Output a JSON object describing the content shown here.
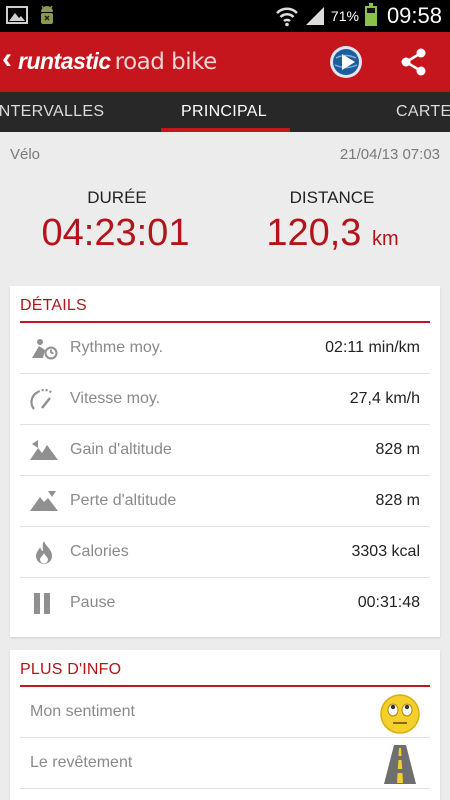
{
  "status_bar": {
    "battery_pct": "71%",
    "battery_level": 0.71,
    "time": "09:58",
    "icons": [
      "image-icon",
      "android-debug-icon",
      "wifi-icon",
      "signal-icon",
      "battery-icon"
    ]
  },
  "app_bar": {
    "brand_primary": "runtastic",
    "brand_secondary": "road bike",
    "icons": [
      "back-chevron-icon",
      "globe-icon",
      "share-icon"
    ]
  },
  "tabs": [
    {
      "label": "INTERVALLES"
    },
    {
      "label": "PRINCIPAL",
      "active": true
    },
    {
      "label": "CARTE"
    }
  ],
  "summary": {
    "sport": "Vélo",
    "datetime": "21/04/13 07:03",
    "duration_label": "DURÉE",
    "duration_value": "04:23:01",
    "distance_label": "DISTANCE",
    "distance_value": "120,3",
    "distance_unit": "km"
  },
  "details": {
    "title": "DÉTAILS",
    "rows": [
      {
        "label": "Rythme moy.",
        "value": "02:11 min/km",
        "icon": "pace-icon"
      },
      {
        "label": "Vitesse moy.",
        "value": "27,4 km/h",
        "icon": "speedometer-icon"
      },
      {
        "label": "Gain d'altitude",
        "value": "828 m",
        "icon": "elevation-gain-icon"
      },
      {
        "label": "Perte d'altitude",
        "value": "828 m",
        "icon": "elevation-loss-icon"
      },
      {
        "label": "Calories",
        "value": "3303 kcal",
        "icon": "flame-icon"
      },
      {
        "label": "Pause",
        "value": "00:31:48",
        "icon": "pause-icon"
      }
    ]
  },
  "more_info": {
    "title": "PLUS D'INFO",
    "rows": [
      {
        "label": "Mon sentiment",
        "icon": "emoji-face-icon"
      },
      {
        "label": "Le revêtement",
        "icon": "road-surface-icon"
      }
    ]
  },
  "colors": {
    "brand_red": "#c4161c",
    "value_red": "#b3141a",
    "tab_bg": "#282828",
    "page_bg": "#ececec"
  }
}
